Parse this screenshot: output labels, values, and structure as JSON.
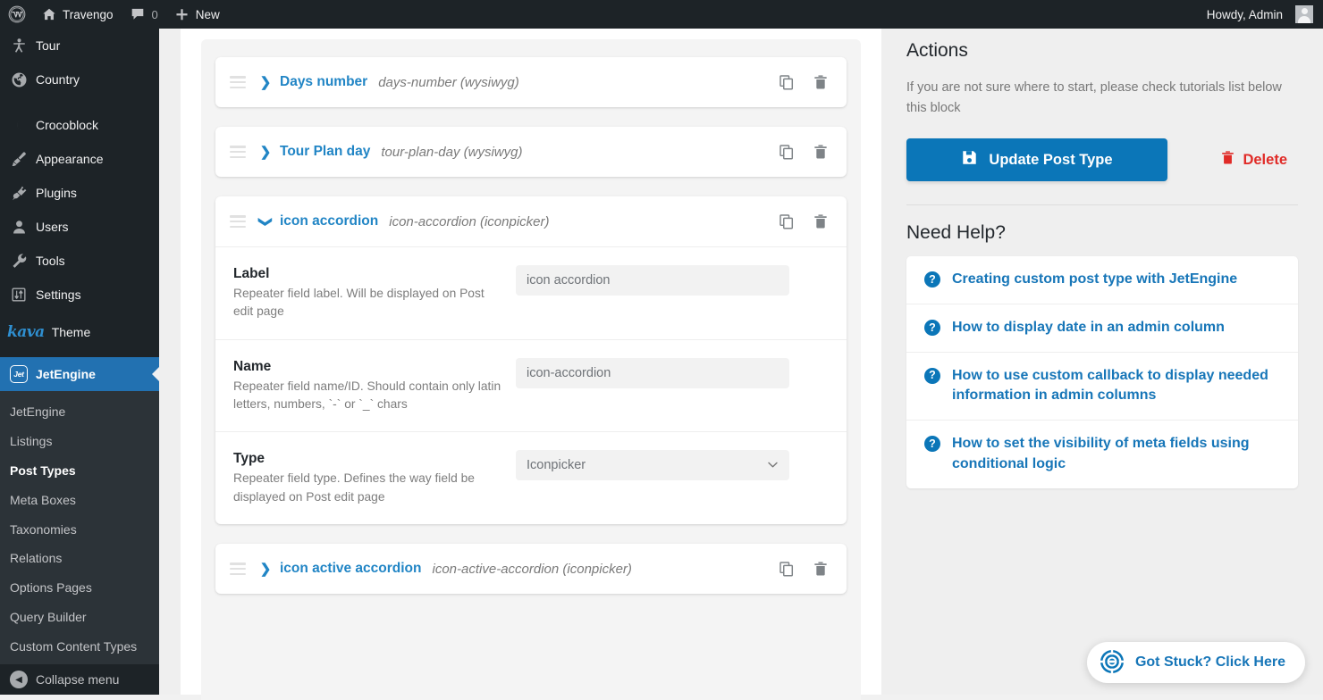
{
  "adminbar": {
    "wp_logo_icon": "wordpress-logo-icon",
    "site_icon": "home-icon",
    "site_name": "Travengo",
    "comments_icon": "comment-bubble-icon",
    "comments_count": "0",
    "new_icon": "plus-icon",
    "new_label": "New",
    "howdy": "Howdy, Admin",
    "avatar_icon": "user-avatar-icon"
  },
  "sidebar": {
    "items": [
      {
        "label": "Tour",
        "icon": "pin-person-icon",
        "current": false
      },
      {
        "label": "Country",
        "icon": "globe-icon",
        "current": false
      },
      {
        "separator": true
      },
      {
        "label": "Crocoblock",
        "icon": "crocoblock-moon-icon",
        "current": false
      },
      {
        "label": "Appearance",
        "icon": "paintbrush-icon",
        "current": false
      },
      {
        "label": "Plugins",
        "icon": "plug-icon",
        "current": false
      },
      {
        "label": "Users",
        "icon": "user-icon",
        "current": false
      },
      {
        "label": "Tools",
        "icon": "wrench-icon",
        "current": false
      },
      {
        "label": "Settings",
        "icon": "sliders-icon",
        "current": false
      }
    ],
    "kava": {
      "logo_text": "kava",
      "label": "Theme"
    },
    "jetengine": {
      "label": "JetEngine",
      "icon": "jetengine-badge-icon",
      "current": true
    },
    "submenu": [
      {
        "label": "JetEngine",
        "current": false
      },
      {
        "label": "Listings",
        "current": false
      },
      {
        "label": "Post Types",
        "current": true
      },
      {
        "label": "Meta Boxes",
        "current": false
      },
      {
        "label": "Taxonomies",
        "current": false
      },
      {
        "label": "Relations",
        "current": false
      },
      {
        "label": "Options Pages",
        "current": false
      },
      {
        "label": "Query Builder",
        "current": false
      },
      {
        "label": "Custom Content Types",
        "current": false
      }
    ],
    "collapse": {
      "label": "Collapse menu",
      "icon": "chevron-left-circle-icon"
    }
  },
  "fields": [
    {
      "title": "Days number",
      "slug": "days-number (wysiwyg)",
      "expanded": false,
      "chevron": "chevron-right-icon",
      "copy_icon": "copy-icon",
      "delete_icon": "trash-icon",
      "handle_icon": "drag-handle-icon"
    },
    {
      "title": "Tour Plan day",
      "slug": "tour-plan-day (wysiwyg)",
      "expanded": false,
      "chevron": "chevron-right-icon",
      "copy_icon": "copy-icon",
      "delete_icon": "trash-icon",
      "handle_icon": "drag-handle-icon"
    },
    {
      "title": "icon accordion",
      "slug": "icon-accordion (iconpicker)",
      "expanded": true,
      "chevron": "chevron-down-icon",
      "copy_icon": "copy-icon",
      "delete_icon": "trash-icon",
      "handle_icon": "drag-handle-icon",
      "rows": [
        {
          "label": "Label",
          "desc": "Repeater field label. Will be displayed on Post edit page",
          "control": "text",
          "value": "icon accordion",
          "placeholder": ""
        },
        {
          "label": "Name",
          "desc": "Repeater field name/ID. Should contain only latin letters, numbers, `-` or `_` chars",
          "control": "text",
          "value": "icon-accordion",
          "placeholder": ""
        },
        {
          "label": "Type",
          "desc": "Repeater field type. Defines the way field be displayed on Post edit page",
          "control": "select",
          "value": "Iconpicker",
          "options": [
            "Iconpicker"
          ]
        }
      ]
    },
    {
      "title": "icon active accordion",
      "slug": "icon-active-accordion (iconpicker)",
      "expanded": false,
      "chevron": "chevron-right-icon",
      "copy_icon": "copy-icon",
      "delete_icon": "trash-icon",
      "handle_icon": "drag-handle-icon"
    }
  ],
  "actions": {
    "heading": "Actions",
    "description": "If you are not sure where to start, please check tutorials list below this block",
    "update_label": "Update Post Type",
    "update_icon": "save-floppy-icon",
    "delete_label": "Delete",
    "delete_icon": "trash-icon"
  },
  "help": {
    "heading": "Need Help?",
    "items": [
      {
        "label": "Creating custom post type with JetEngine",
        "icon": "question-circle-icon"
      },
      {
        "label": "How to display date in an admin column",
        "icon": "question-circle-icon"
      },
      {
        "label": "How to use custom callback to display needed information in admin columns",
        "icon": "question-circle-icon"
      },
      {
        "label": "How to set the visibility of meta fields using conditional logic",
        "icon": "question-circle-icon"
      }
    ]
  },
  "support_fab": {
    "label": "Got Stuck? Click Here",
    "icon": "lifebuoy-icon"
  },
  "colors": {
    "admin_dark": "#1d2327",
    "admin_submenu": "#2c3338",
    "accent_blue": "#2271b1",
    "link_blue": "#2185c5",
    "button_blue": "#0b76b8",
    "danger_red": "#e02b27",
    "panel_gray": "#f4f4f4",
    "sidebar_gray": "#efefef"
  }
}
